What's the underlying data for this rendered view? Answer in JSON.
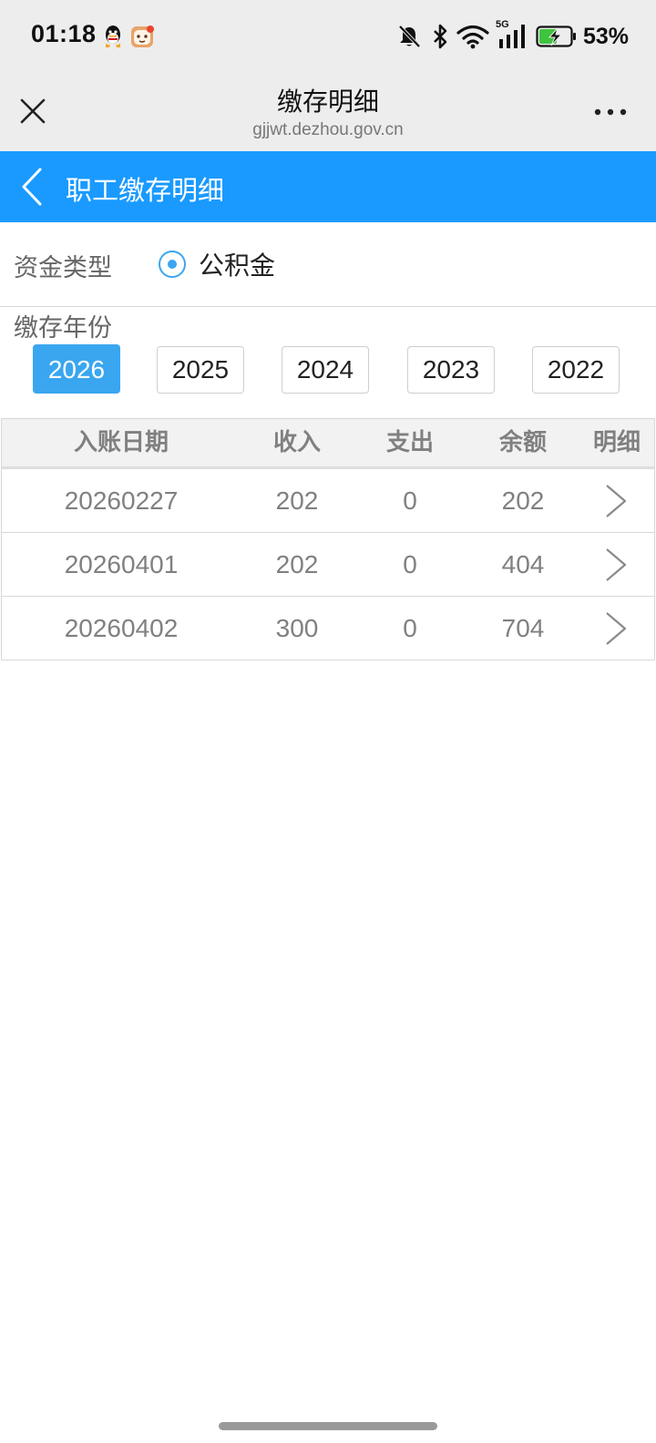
{
  "status_bar": {
    "time": "01:18",
    "network": "5G",
    "battery": "53%",
    "icons": [
      "qq-icon",
      "app-notification-icon",
      "bell-muted-icon",
      "bluetooth-icon",
      "wifi-icon",
      "signal-icon",
      "battery-charging-icon"
    ],
    "battery_level": 0.53
  },
  "browser": {
    "title": "缴存明细",
    "url": "gjjwt.dezhou.gov.cn",
    "close_icon": "close-icon",
    "more_icon": "more-icon"
  },
  "header": {
    "title": "职工缴存明细",
    "back_icon": "chevron-left-icon",
    "color": "#1a9aff"
  },
  "fund_type": {
    "label": "资金类型",
    "option": "公积金",
    "selected": true
  },
  "years": {
    "label": "缴存年份",
    "items": [
      "2026",
      "2025",
      "2024",
      "2023",
      "2022"
    ],
    "selected": "2026",
    "active_color": "#3aa6f0"
  },
  "table": {
    "columns": [
      "入账日期",
      "收入",
      "支出",
      "余额",
      "明细"
    ],
    "rows": [
      {
        "date": "20260227",
        "income": "202",
        "expense": "0",
        "balance": "202"
      },
      {
        "date": "20260401",
        "income": "202",
        "expense": "0",
        "balance": "404"
      },
      {
        "date": "20260402",
        "income": "300",
        "expense": "0",
        "balance": "704"
      }
    ],
    "detail_icon": "chevron-right-icon"
  }
}
